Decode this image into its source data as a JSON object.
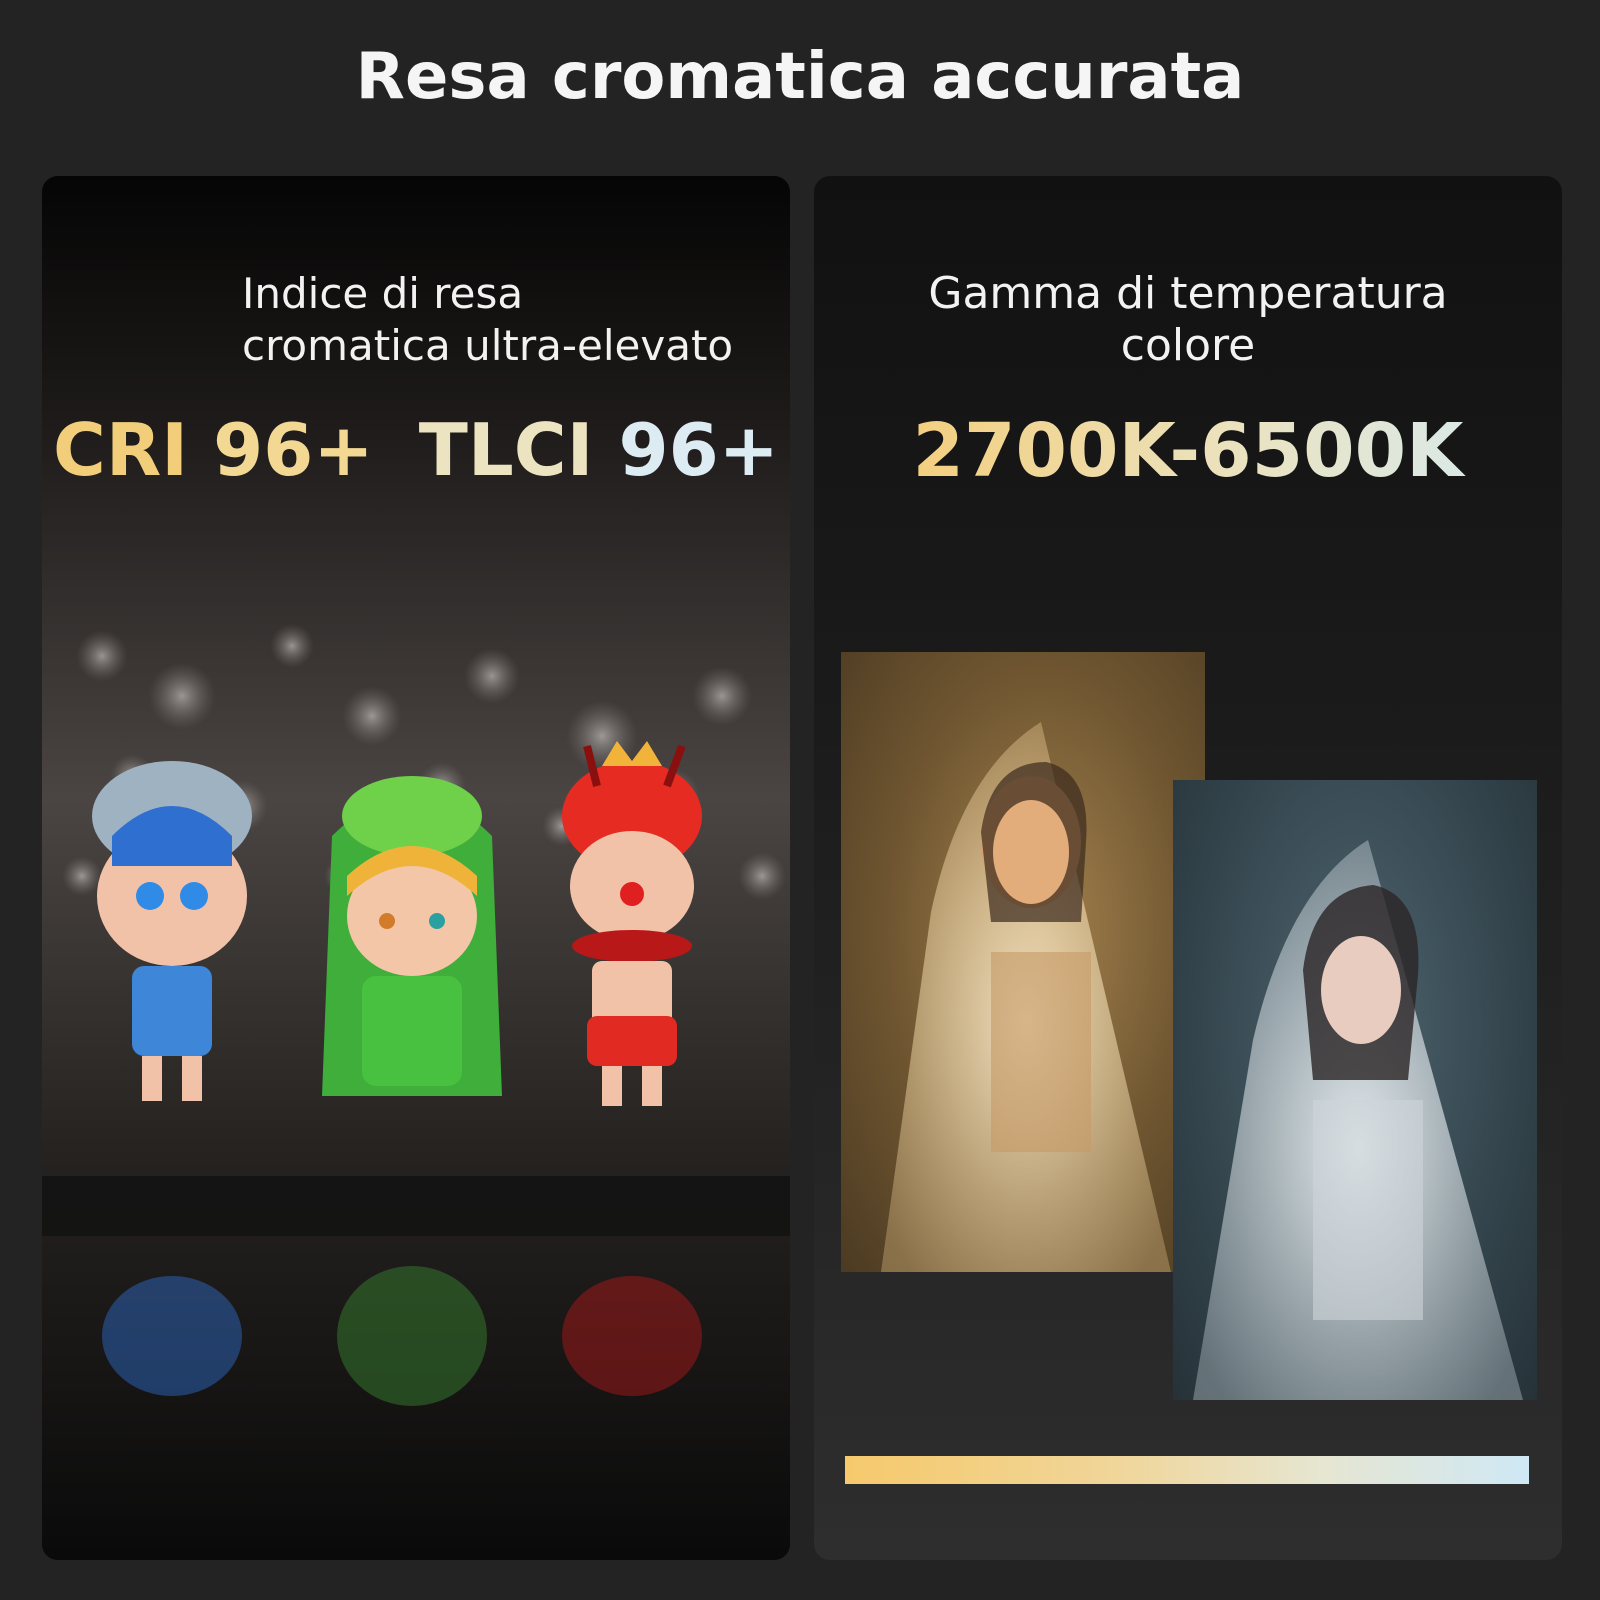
{
  "title": "Resa cromatica accurata",
  "left_panel": {
    "subtitle_line1": "Indice di resa",
    "subtitle_line2": "cromatica ultra-elevato",
    "cri_label": "CRI",
    "cri_value": "96+",
    "tlci_label": "TLCI",
    "tlci_value": "96+",
    "photo_alt": "Figurines on reflective surface with bokeh"
  },
  "right_panel": {
    "subtitle_line1": "Gamma di temperatura",
    "subtitle_line2": "colore",
    "range": "2700K-6500K",
    "warm_photo_alt": "Portrait under warm light",
    "cool_photo_alt": "Portrait under cool light"
  },
  "colors": {
    "background": "#232323",
    "warm": "#f6c96c",
    "cool": "#d4ecf6"
  }
}
